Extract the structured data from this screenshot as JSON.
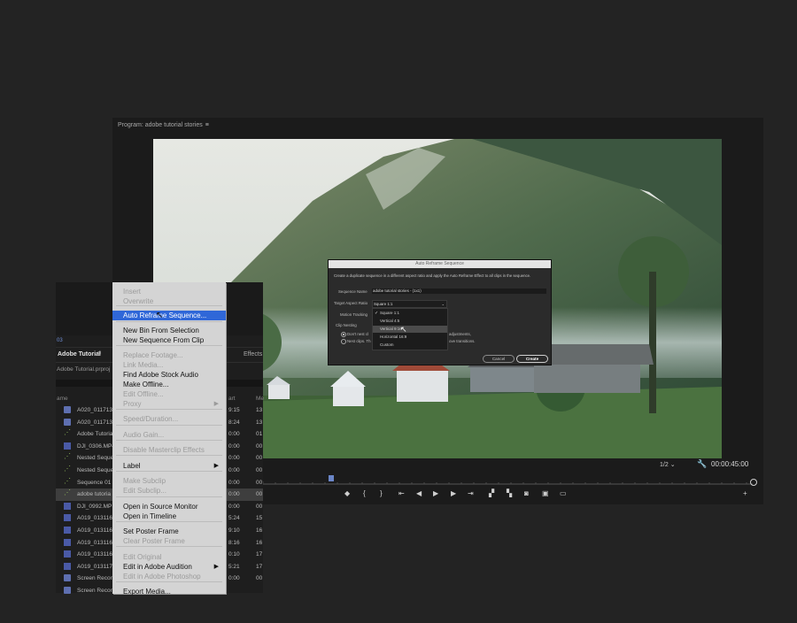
{
  "program_monitor": {
    "title": "Program: adobe tutorial stories",
    "menu_icon": "hamburger-icon",
    "zoom": "1/2",
    "timecode": "00:00:45:00",
    "transport_icons": [
      "marker-icon",
      "in-point-icon",
      "out-point-icon",
      "go-to-in-icon",
      "step-back-icon",
      "play-icon",
      "step-forward-icon",
      "go-to-out-icon",
      "lift-icon",
      "extract-icon",
      "export-frame-icon",
      "comparison-view-icon",
      "safe-margins-icon",
      "add-icon"
    ]
  },
  "project_panel": {
    "small_label": "03",
    "tab_label": "Adobe Tutorial",
    "effects_tab": "Effects",
    "file_name": "Adobe Tutorial.prproj",
    "columns": {
      "name": "ame",
      "start": "art",
      "media": "Me"
    },
    "rows": [
      {
        "name": "A020_0117131",
        "start": "9:15",
        "media": "13",
        "type": "seq"
      },
      {
        "name": "A020_0117131",
        "start": "8:24",
        "media": "13",
        "type": "seq"
      },
      {
        "name": "Adobe Tutorial",
        "start": "0:00",
        "media": "01",
        "type": "nest"
      },
      {
        "name": "DJI_0306.MP4",
        "start": "0:00",
        "media": "00",
        "type": "vid"
      },
      {
        "name": "Nested Seque",
        "start": "0:00",
        "media": "00",
        "type": "nest"
      },
      {
        "name": "Nested Seque",
        "start": "0:00",
        "media": "00",
        "type": "nest"
      },
      {
        "name": "Sequence 01",
        "start": "0:00",
        "media": "00",
        "type": "nest"
      },
      {
        "name": "adobe tutoria",
        "start": "0:00",
        "media": "00",
        "type": "nest",
        "selected": true
      },
      {
        "name": "DJI_0992.MP",
        "start": "0:00",
        "media": "00",
        "type": "vid"
      },
      {
        "name": "A019_013116",
        "start": "5:24",
        "media": "15",
        "type": "vid"
      },
      {
        "name": "A019_013116",
        "start": "9:10",
        "media": "16",
        "type": "vid"
      },
      {
        "name": "A019_013116",
        "start": "8:16",
        "media": "16",
        "type": "vid"
      },
      {
        "name": "A019_013116",
        "start": "0:10",
        "media": "17",
        "type": "vid"
      },
      {
        "name": "A019_013117",
        "start": "5:21",
        "media": "17",
        "type": "vid"
      },
      {
        "name": "Screen Record",
        "start": "0:00",
        "media": "00",
        "type": "seq"
      },
      {
        "name": "Screen Record",
        "start": "",
        "media": "",
        "type": "seq"
      }
    ]
  },
  "context_menu": {
    "items": [
      {
        "label": "Insert",
        "disabled": true
      },
      {
        "label": "Overwrite",
        "disabled": true
      },
      {
        "label": "Auto Reframe Sequence...",
        "highlighted": true
      },
      {
        "label": "New Bin From Selection"
      },
      {
        "label": "New Sequence From Clip"
      },
      {
        "label": "Replace Footage...",
        "disabled": true
      },
      {
        "label": "Link Media...",
        "disabled": true
      },
      {
        "label": "Find Adobe Stock Audio"
      },
      {
        "label": "Make Offline..."
      },
      {
        "label": "Edit Offline...",
        "disabled": true
      },
      {
        "label": "Proxy",
        "disabled": true,
        "submenu": true
      },
      {
        "label": "Speed/Duration...",
        "disabled": true
      },
      {
        "label": "Audio Gain...",
        "disabled": true
      },
      {
        "label": "Disable Masterclip Effects",
        "disabled": true
      },
      {
        "label": "Label",
        "submenu": true
      },
      {
        "label": "Make Subclip",
        "disabled": true
      },
      {
        "label": "Edit Subclip...",
        "disabled": true
      },
      {
        "label": "Open in Source Monitor"
      },
      {
        "label": "Open in Timeline"
      },
      {
        "label": "Set Poster Frame"
      },
      {
        "label": "Clear Poster Frame",
        "disabled": true
      },
      {
        "label": "Edit Original",
        "disabled": true
      },
      {
        "label": "Edit in Adobe Audition",
        "submenu": true
      },
      {
        "label": "Edit in Adobe Photoshop",
        "disabled": true
      },
      {
        "label": "Export Media..."
      }
    ]
  },
  "dialog": {
    "title": "Auto Reframe Sequence",
    "description": "Create a duplicate sequence in a different aspect ratio and apply the Auto Reframe Effect to all clips in the sequence.",
    "sequence_name_label": "Sequence Name",
    "sequence_name_value": "adobe tutorial stories - (1x1)",
    "aspect_label": "Target Aspect Ratio",
    "aspect_value": "Square 1:1",
    "motion_label": "Motion Tracking",
    "clip_nesting_label": "Clip Nesting",
    "nest_option_1": "Don't nest cl",
    "nest_option_1_tail": "adjustments,",
    "nest_option_2": "Nest clips. Th",
    "nest_option_2_tail": "ove transitions.",
    "options": [
      "Square 1:1",
      "Vertical 4:5",
      "Vertical 9:16",
      "Horizontal 16:9",
      "Custom"
    ],
    "selected_option": "Square 1:1",
    "hovered_option": "Vertical 9:16",
    "cancel": "Cancel",
    "create": "Create"
  }
}
